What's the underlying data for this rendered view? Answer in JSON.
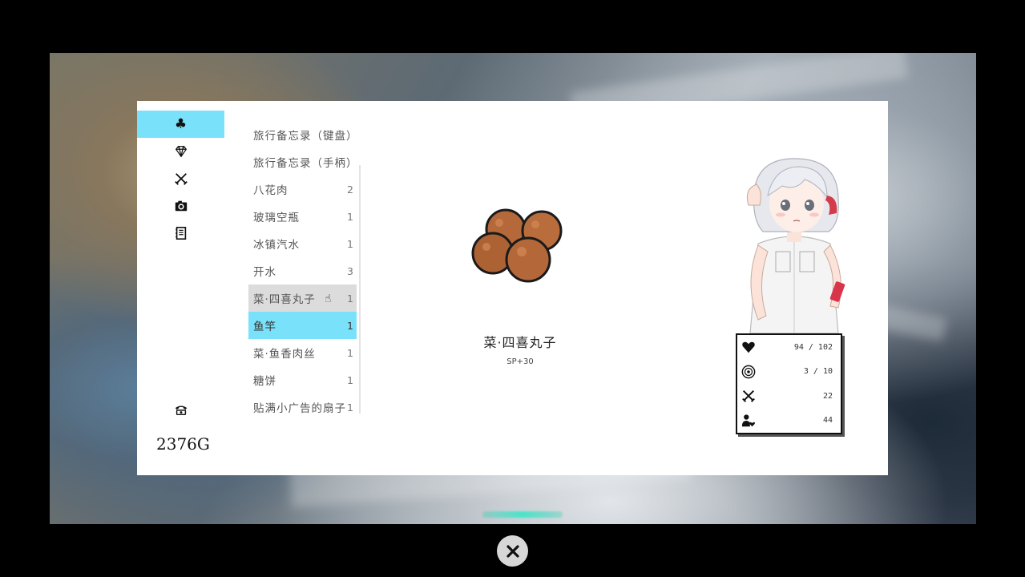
{
  "currency": {
    "gold": "2376G"
  },
  "tabs": [
    {
      "icon": "clover-icon",
      "active": true
    },
    {
      "icon": "diamond-icon",
      "active": false
    },
    {
      "icon": "crossed-swords-icon",
      "active": false
    },
    {
      "icon": "camera-icon",
      "active": false
    },
    {
      "icon": "notebook-icon",
      "active": false
    }
  ],
  "items": [
    {
      "name": "旅行备忘录（键盘）",
      "count": ""
    },
    {
      "name": "旅行备忘录（手柄）",
      "count": ""
    },
    {
      "name": "八花肉",
      "count": "2"
    },
    {
      "name": "玻璃空瓶",
      "count": "1"
    },
    {
      "name": "冰镇汽水",
      "count": "1"
    },
    {
      "name": "开水",
      "count": "3"
    },
    {
      "name": "菜·四喜丸子",
      "count": "1"
    },
    {
      "name": "鱼竿",
      "count": "1"
    },
    {
      "name": "菜·鱼香肉丝",
      "count": "1"
    },
    {
      "name": "糖饼",
      "count": "1"
    },
    {
      "name": "贴满小广告的扇子",
      "count": "1"
    }
  ],
  "detail": {
    "name": "菜·四喜丸子",
    "effect": "SP+30"
  },
  "stats": [
    {
      "icon": "heart-icon",
      "value": "94 / 102"
    },
    {
      "icon": "target-icon",
      "value": "3 / 10"
    },
    {
      "icon": "crossed-swords-icon",
      "value": "22"
    },
    {
      "icon": "affection-icon",
      "value": "44"
    }
  ],
  "colors": {
    "accent": "#7ae1fa",
    "hover": "#dcdcdc",
    "meatball": "#b5683a"
  }
}
